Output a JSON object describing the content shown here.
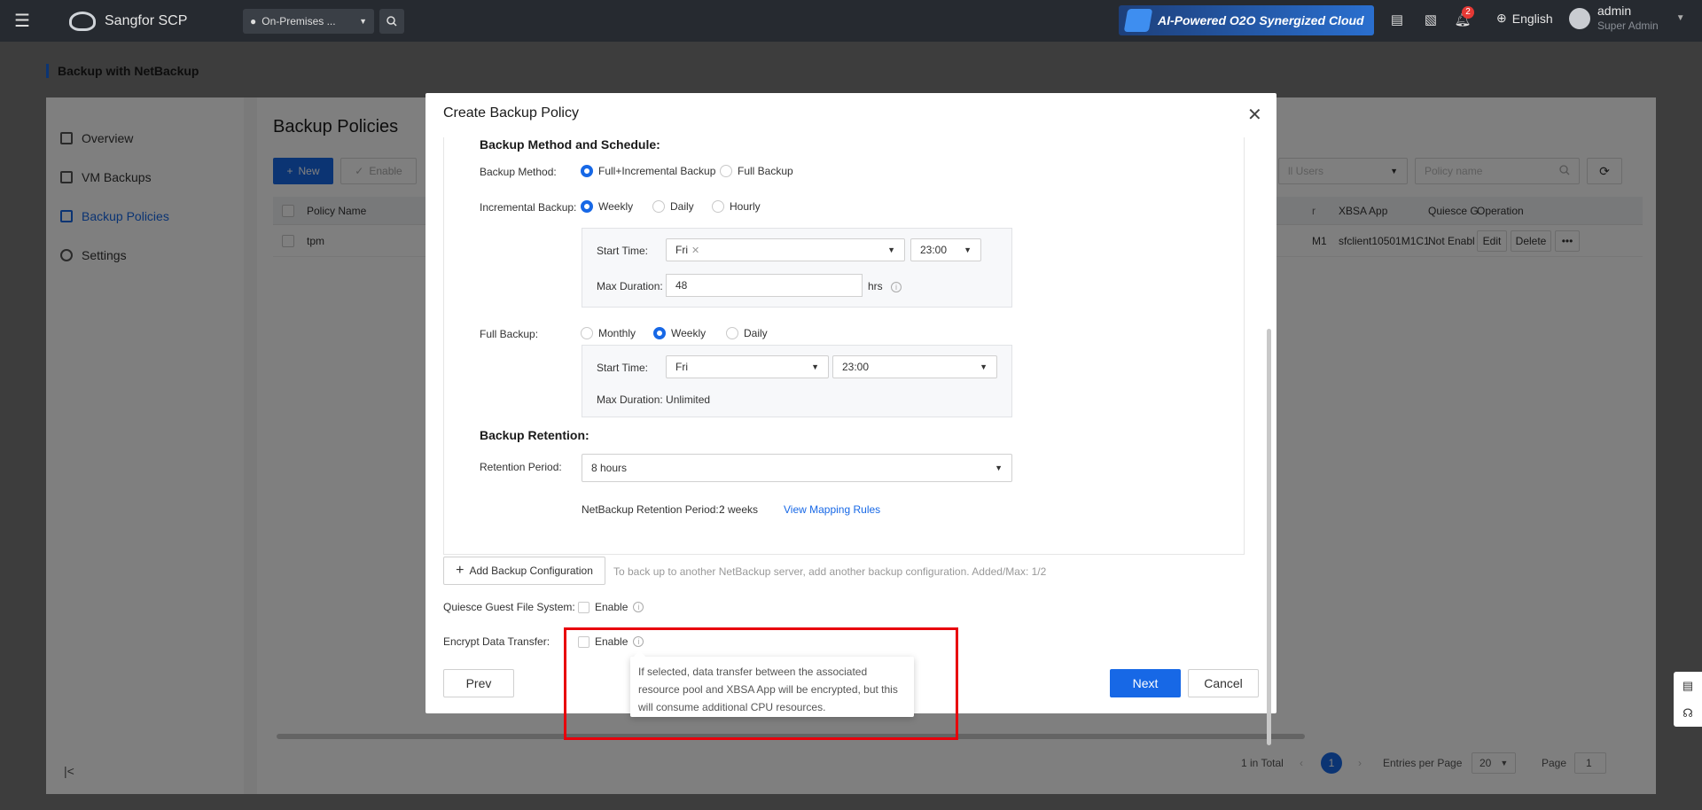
{
  "topbar": {
    "brand": "Sangfor SCP",
    "environment": "On-Premises ...",
    "banner": "AI-Powered O2O Synergized Cloud",
    "notification_count": "2",
    "language": "English",
    "user_name": "admin",
    "user_role": "Super Admin"
  },
  "page": {
    "title": "Backup with NetBackup",
    "sidebar": {
      "items": [
        {
          "label": "Overview",
          "icon": "grid-icon"
        },
        {
          "label": "VM Backups",
          "icon": "layers-icon"
        },
        {
          "label": "Backup Policies",
          "icon": "document-icon",
          "active": true
        },
        {
          "label": "Settings",
          "icon": "gear-icon"
        }
      ]
    },
    "main": {
      "heading": "Backup Policies",
      "new_button": "New",
      "enable_button": "Enable",
      "user_filter_placeholder": "ll Users",
      "search_placeholder": "Policy name",
      "columns": [
        "Policy Name",
        "r",
        "XBSA App",
        "Quiesce G",
        "Operation"
      ],
      "rows": [
        {
          "policy_name": "tpm",
          "partial": "M1",
          "xbsa_app": "sfclient10501M1C1",
          "quiesce": "Not Enable",
          "edit": "Edit",
          "delete": "Delete",
          "more": "•••"
        }
      ]
    },
    "pagination": {
      "total": "1 in Total",
      "current_page": "1",
      "entries_label": "Entries per Page",
      "entries_value": "20",
      "page_label": "Page",
      "page_value": "1"
    }
  },
  "modal": {
    "title": "Create Backup Policy",
    "section_schedule": "Backup Method and Schedule:",
    "backup_method_label": "Backup Method:",
    "backup_method_options": [
      "Full+Incremental Backup",
      "Full Backup"
    ],
    "incremental_label": "Incremental Backup:",
    "incremental_options": [
      "Weekly",
      "Daily",
      "Hourly"
    ],
    "incr_start_time_label": "Start Time:",
    "incr_day_tag": "Fri",
    "incr_time": "23:00",
    "max_duration_label": "Max Duration:",
    "max_duration_value": "48",
    "max_duration_unit": "hrs",
    "full_backup_label": "Full Backup:",
    "full_options": [
      "Monthly",
      "Weekly",
      "Daily"
    ],
    "full_start_time_label": "Start Time:",
    "full_day": "Fri",
    "full_time": "23:00",
    "full_max_duration": "Max Duration: Unlimited",
    "section_retention": "Backup Retention:",
    "retention_label": "Retention Period:",
    "retention_value": "8 hours",
    "netbackup_retention_label": "NetBackup Retention Period: :",
    "netbackup_retention_value": "2 weeks",
    "mapping_link": "View Mapping Rules",
    "add_config_button": "Add Backup Configuration",
    "add_config_hint": "To back up to another NetBackup server, add another backup configuration. Added/Max: 1/2",
    "quiesce_label": "Quiesce Guest File System:",
    "quiesce_checkbox": "Enable",
    "encrypt_label": "Encrypt Data Transfer:",
    "encrypt_checkbox": "Enable",
    "tooltip": "If selected, data transfer between the associated resource pool and XBSA App will be encrypted, but this will consume additional CPU resources.",
    "prev_button": "Prev",
    "next_button": "Next",
    "cancel_button": "Cancel"
  },
  "colors": {
    "primary": "#1768e6",
    "highlight": "#e8000b",
    "topbar": "#262a30"
  }
}
